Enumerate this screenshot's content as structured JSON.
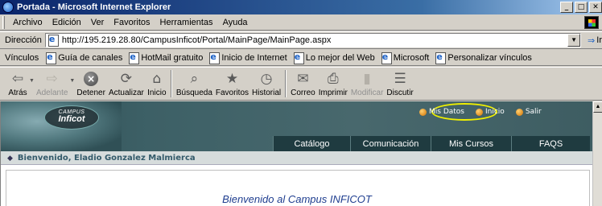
{
  "window": {
    "title": "Portada - Microsoft Internet Explorer",
    "buttons": [
      "_",
      "□",
      "✕"
    ]
  },
  "menu": [
    "Archivo",
    "Edición",
    "Ver",
    "Favoritos",
    "Herramientas",
    "Ayuda"
  ],
  "menu_mnemonic": [
    "A",
    "E",
    "V",
    "F",
    "H",
    "u"
  ],
  "address": {
    "label": "Dirección",
    "url": "http://195.219.28.80/CampusInficot/Portal/MainPage/MainPage.aspx",
    "go_label": "Ir"
  },
  "links": {
    "label": "Vínculos",
    "items": [
      "Guía de canales",
      "HotMail gratuito",
      "Inicio de Internet",
      "Lo mejor del Web",
      "Microsoft",
      "Personalizar vínculos"
    ]
  },
  "toolbar": {
    "back": "Atrás",
    "forward": "Adelante",
    "stop": "Detener",
    "refresh": "Actualizar",
    "home": "Inicio",
    "search": "Búsqueda",
    "favorites": "Favoritos",
    "history": "Historial",
    "mail": "Correo",
    "print": "Imprimir",
    "edit": "Modificar",
    "discuss": "Discutir"
  },
  "site": {
    "logo_small": "CAMPUS",
    "logo_big": "Inficot",
    "quicklinks": [
      "Mis Datos",
      "Inicio",
      "Salir"
    ],
    "tabs": [
      "Catálogo",
      "Comunicación",
      "Mis Cursos",
      "FAQS"
    ],
    "welcome": "Bienvenido, Eladio Gonzalez Malmierca",
    "heading": "Bienvenido al Campus INFICOT"
  },
  "colors": {
    "title_bar": "#0a246a",
    "site_header": "#3d6066",
    "highlight": "#f0f000",
    "heading": "#1e3d8f"
  }
}
